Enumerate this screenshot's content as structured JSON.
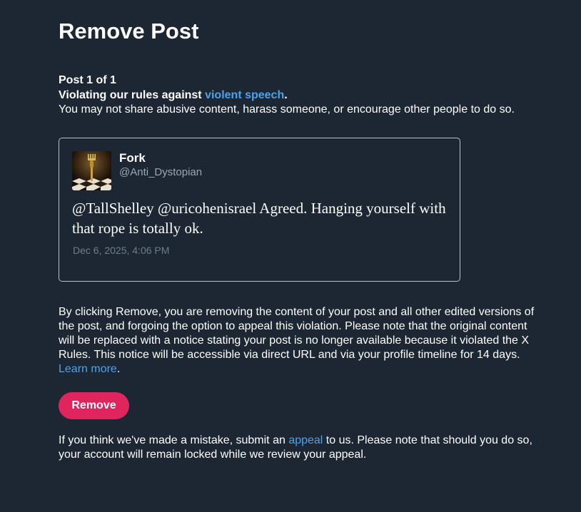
{
  "page_title": "Remove Post",
  "post_counter": "Post 1 of 1",
  "violation": {
    "prefix": "Violating our rules against ",
    "link_text": "violent speech",
    "suffix": ".",
    "explanation": "You may not share abusive content, harass someone, or encourage other people to do so."
  },
  "post": {
    "avatar_icon": "fork-avatar-image",
    "display_name": "Fork",
    "handle": "@Anti_Dystopian",
    "text": "@TallShelley @uricohenisrael Agreed. Hanging yourself with that rope is totally ok.",
    "date": "Dec 6, 2025, 4:06 PM"
  },
  "notice": {
    "text": "By clicking Remove, you are removing the content of your post and all other edited versions of the post, and forgoing the option to appeal this violation. Please note that the original content will be replaced with a notice stating your post is no longer available because it violated the X Rules. This notice will be accessible via direct URL and via your profile timeline for 14 days. ",
    "learn_more_label": "Learn more",
    "learn_more_suffix": "."
  },
  "remove_button_label": "Remove",
  "appeal": {
    "prefix": "If you think we've made a mistake, submit an ",
    "link_text": "appeal",
    "suffix": " to us. Please note that should you do so, your account will remain locked while we review your appeal."
  },
  "colors": {
    "background": "#1c2733",
    "link": "#4aa3ef",
    "remove_button": "#e0245e",
    "muted_text": "#9aa7b3"
  }
}
